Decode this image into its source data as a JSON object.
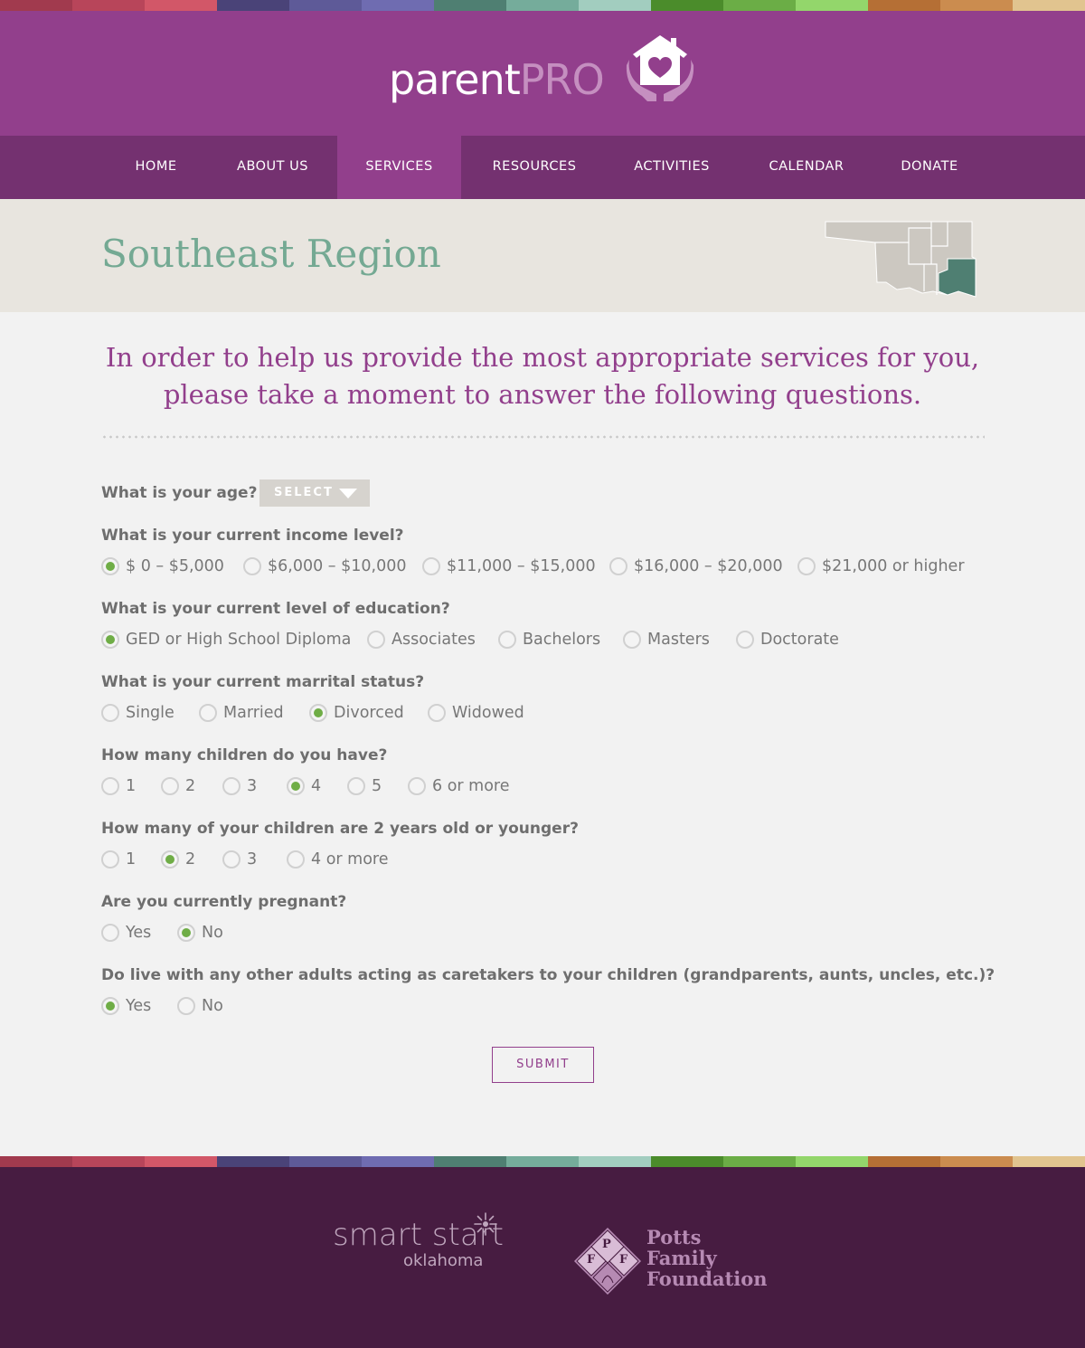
{
  "brand": {
    "logo_parent": "parent",
    "logo_pro": "PRO",
    "colors": {
      "header": "#923f8c",
      "nav": "#743170",
      "accent_green": "#6fad46",
      "region_teal": "#74a993",
      "footer": "#471c41"
    },
    "stripe_colors": [
      "#a13a4e",
      "#b8455a",
      "#d25768",
      "#4a4378",
      "#5e5a98",
      "#6f6cb1",
      "#4f7f72",
      "#75ac9b",
      "#a2cdbf",
      "#4b8c2b",
      "#6bad46",
      "#93d66b",
      "#b56f35",
      "#cb8c4f",
      "#e1c48f"
    ]
  },
  "nav": {
    "items": [
      {
        "label": "HOME"
      },
      {
        "label": "ABOUT US"
      },
      {
        "label": "SERVICES"
      },
      {
        "label": "RESOURCES"
      },
      {
        "label": "ACTIVITIES"
      },
      {
        "label": "CALENDAR"
      },
      {
        "label": "DONATE"
      }
    ],
    "active": "SERVICES"
  },
  "region": {
    "title": "Southeast Region",
    "map_icon": "oklahoma-map-icon"
  },
  "intro": {
    "line1": "In order to help us provide the most appropriate services for you,",
    "line2": "please take a moment to answer the following questions."
  },
  "form": {
    "age": {
      "question": "What is your age?",
      "select_label": "SELECT"
    },
    "income": {
      "question": "What is your current income level?",
      "options": [
        "$ 0 – $5,000",
        "$6,000 – $10,000",
        "$11,000 – $15,000",
        "$16,000 – $20,000",
        "$21,000 or higher"
      ],
      "selected": "$ 0 – $5,000"
    },
    "education": {
      "question": "What is your current level of education?",
      "options": [
        "GED or High School Diploma",
        "Associates",
        "Bachelors",
        "Masters",
        "Doctorate"
      ],
      "selected": "GED or High School Diploma"
    },
    "marital": {
      "question": "What is your current marrital status?",
      "options": [
        "Single",
        "Married",
        "Divorced",
        "Widowed"
      ],
      "selected": "Divorced"
    },
    "children": {
      "question": "How many children do you have?",
      "options": [
        "1",
        "2",
        "3",
        "4",
        "5",
        "6 or more"
      ],
      "selected": "4"
    },
    "young_children": {
      "question": "How many of your children are 2 years old or younger?",
      "options": [
        "1",
        "2",
        "3",
        "4 or more"
      ],
      "selected": "2"
    },
    "pregnant": {
      "question": "Are you currently pregnant?",
      "options": [
        "Yes",
        "No"
      ],
      "selected": "No"
    },
    "caretakers": {
      "question": "Do live with any other adults acting as caretakers to your children (grandparents, aunts, uncles, etc.)?",
      "options": [
        "Yes",
        "No"
      ],
      "selected": "Yes"
    },
    "submit_label": "SUBMIT"
  },
  "footer": {
    "smart_start_word": "smart start",
    "smart_start_sub": "oklahoma",
    "pff_letters": [
      "P",
      "F",
      "F"
    ],
    "pff_line1": "Potts",
    "pff_line2": "Family",
    "pff_line3": "Foundation"
  }
}
